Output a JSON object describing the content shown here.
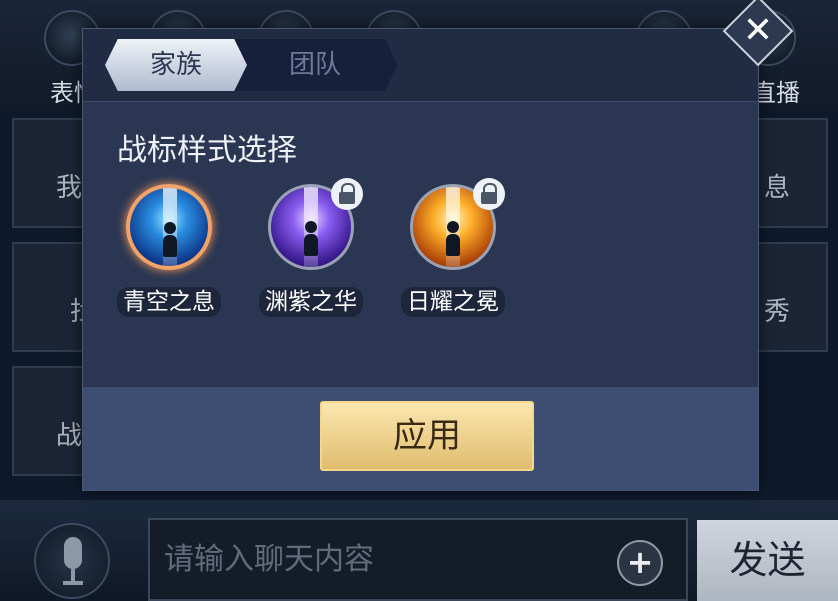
{
  "background": {
    "top_left_label": "表情",
    "top_right_label": "直播",
    "side_left_labels": [
      "我",
      "找",
      "战"
    ],
    "side_right_labels": [
      "息",
      "秀"
    ]
  },
  "dialog": {
    "tabs": [
      {
        "label": "家族",
        "active": true
      },
      {
        "label": "团队",
        "active": false
      }
    ],
    "section_title": "战标样式选择",
    "emblems": [
      {
        "name": "青空之息",
        "color": "blue",
        "locked": false,
        "selected": true
      },
      {
        "name": "渊紫之华",
        "color": "purple",
        "locked": true,
        "selected": false
      },
      {
        "name": "日耀之冕",
        "color": "orange",
        "locked": true,
        "selected": false
      }
    ],
    "apply_label": "应用",
    "close_label": "✕"
  },
  "chat": {
    "input_placeholder": "请输入聊天内容",
    "plus_label": "+",
    "send_label": "发送"
  }
}
